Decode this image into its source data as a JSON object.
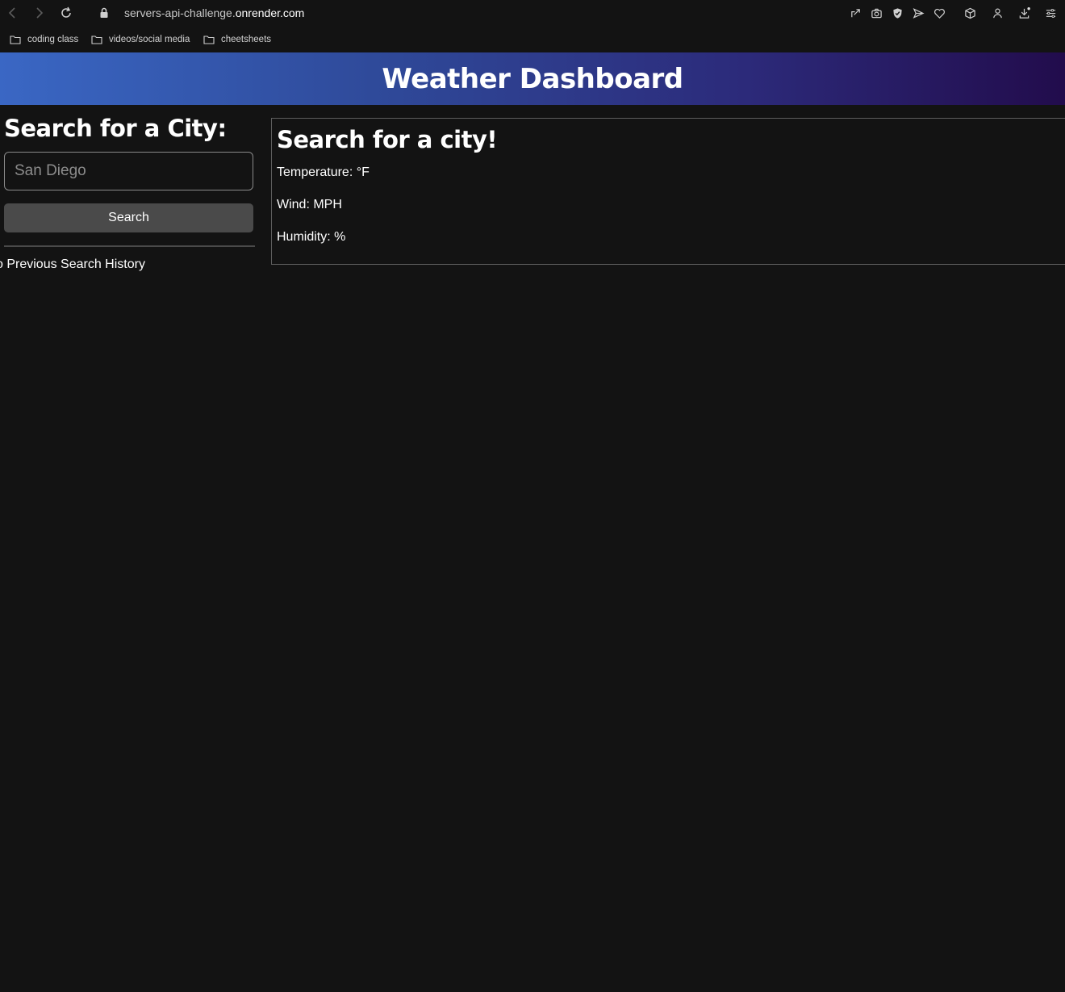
{
  "browser": {
    "url_host": "servers-api-challenge.",
    "url_domain": "onrender.com",
    "bookmarks": [
      "coding class",
      "videos/social media",
      "cheetsheets"
    ]
  },
  "header": {
    "title": "Weather Dashboard"
  },
  "sidebar": {
    "search_heading": "Search for a City:",
    "city_input_placeholder": "San Diego",
    "city_input_value": "",
    "search_button": "Search",
    "history_title": "o Previous Search History"
  },
  "weather": {
    "title": "Search for a city!",
    "temperature": "Temperature: °F",
    "wind": "Wind: MPH",
    "humidity": "Humidity: %"
  },
  "colors": {
    "background": "#131313",
    "header_gradient_start": "#3a67c4",
    "header_gradient_end": "#220c4c",
    "button": "#4a4a4a"
  }
}
